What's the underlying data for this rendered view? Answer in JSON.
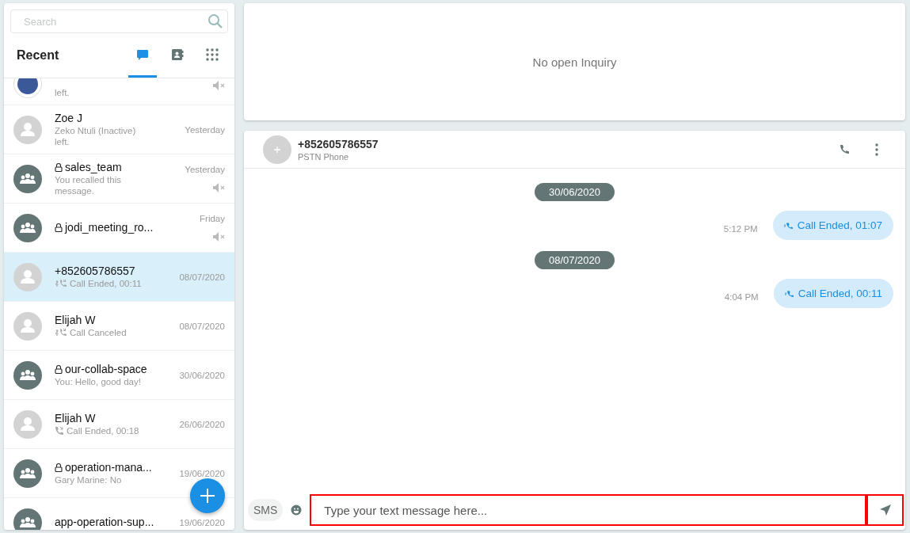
{
  "sidebar": {
    "search": {
      "placeholder": "Search"
    },
    "title": "Recent",
    "tabs": [
      {
        "kind": "chats",
        "selected": true
      },
      {
        "kind": "contacts",
        "selected": false
      },
      {
        "kind": "dialpad",
        "selected": false
      }
    ],
    "conversations": [
      {
        "kind": "other",
        "locked": false,
        "call": false,
        "preview": "left.",
        "muted": true,
        "selected": false
      },
      {
        "kind": "person",
        "locked": false,
        "name": "Zoe J",
        "call": false,
        "preview": "Zeko Ntuli (Inactive) left.",
        "date": "Yesterday",
        "muted": false,
        "selected": false
      },
      {
        "kind": "group",
        "locked": true,
        "name": "sales_team",
        "call": false,
        "preview": "You recalled this message.",
        "date": "Yesterday",
        "muted": true,
        "selected": false
      },
      {
        "kind": "group",
        "locked": true,
        "name": "jodi_meeting_ro...",
        "call": false,
        "date": "Friday",
        "muted": true,
        "selected": false
      },
      {
        "kind": "person",
        "locked": false,
        "name": "+852605786557",
        "call": true,
        "pstn": true,
        "preview": "Call Ended, 00:11",
        "date": "08/07/2020",
        "muted": false,
        "selected": true
      },
      {
        "kind": "person",
        "locked": false,
        "name": "Elijah W",
        "call": true,
        "pstn": true,
        "preview": "Call Canceled",
        "date": "08/07/2020",
        "muted": false,
        "selected": false
      },
      {
        "kind": "group",
        "locked": true,
        "name": "our-collab-space",
        "call": false,
        "preview": "You: Hello, good day!",
        "date": "30/06/2020",
        "muted": false,
        "selected": false
      },
      {
        "kind": "person",
        "locked": false,
        "name": "Elijah W",
        "call": true,
        "pstn": false,
        "preview": "Call Ended, 00:18",
        "date": "26/06/2020",
        "muted": false,
        "selected": false
      },
      {
        "kind": "group",
        "locked": true,
        "name": "operation-mana...",
        "call": false,
        "preview": "Gary Marine: No",
        "date": "19/06/2020",
        "muted": false,
        "selected": false
      },
      {
        "kind": "group",
        "locked": false,
        "name": "app-operation-sup...",
        "call": false,
        "date": "19/06/2020",
        "muted": false,
        "selected": false
      }
    ]
  },
  "inquiry": {
    "text": "No open Inquiry"
  },
  "chat": {
    "name": "+852605786557",
    "subtitle": "PSTN Phone",
    "messages": [
      {
        "kind": "date",
        "text": "30/06/2020"
      },
      {
        "kind": "call",
        "time": "5:12 PM",
        "text": "Call Ended, 01:07"
      },
      {
        "kind": "date",
        "text": "08/07/2020"
      },
      {
        "kind": "call",
        "time": "4:04 PM",
        "text": "Call Ended, 00:11"
      }
    ],
    "composer": {
      "mode": "SMS",
      "placeholder": "Type your text message here..."
    }
  }
}
